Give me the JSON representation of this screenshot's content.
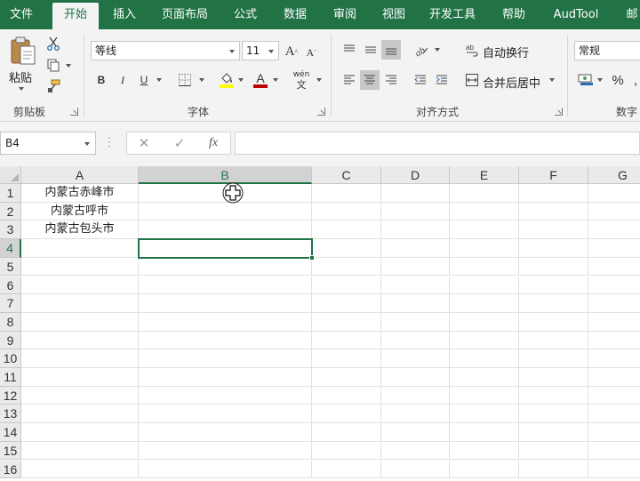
{
  "tabs": [
    "文件",
    "开始",
    "插入",
    "页面布局",
    "公式",
    "数据",
    "审阅",
    "视图",
    "开发工具",
    "帮助",
    "AudTool",
    "邮"
  ],
  "active_tab_index": 1,
  "ribbon": {
    "clipboard": {
      "paste_label": "粘贴",
      "group_label": "剪贴板"
    },
    "font": {
      "font_name": "等线",
      "font_size": "11",
      "group_label": "字体",
      "phonetic_top": "wén",
      "phonetic_bottom": "文"
    },
    "alignment": {
      "wrap_text_label": "自动换行",
      "merge_center_label": "合并后居中",
      "group_label": "对齐方式"
    },
    "number": {
      "format_value": "常规",
      "group_label_partial": "数字",
      "percent_symbol": "%"
    }
  },
  "formula_bar": {
    "name_box": "B4",
    "cancel_symbol": "✕",
    "enter_symbol": "✓",
    "function_symbol": "fx",
    "formula_value": ""
  },
  "sheet": {
    "columns": [
      "A",
      "B",
      "C",
      "D",
      "E",
      "F",
      "G"
    ],
    "rows": [
      "1",
      "2",
      "3",
      "4",
      "5",
      "6",
      "7",
      "8",
      "9",
      "10",
      "11",
      "12",
      "13",
      "14",
      "15",
      "16"
    ],
    "selected_cell": "B4",
    "cells": {
      "A1": "内蒙古赤峰市",
      "A2": "内蒙古呼市",
      "A3": "内蒙古包头市"
    }
  },
  "colors": {
    "accent": "#217346",
    "font_color_bar": "#c00000",
    "highlight_bar": "#ffff00"
  }
}
